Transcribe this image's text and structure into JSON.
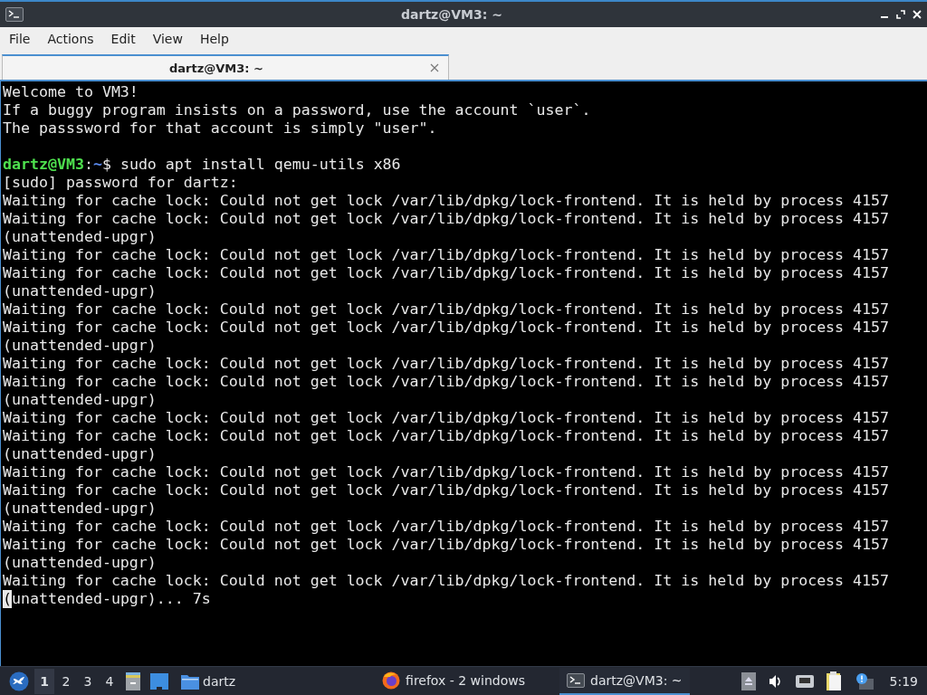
{
  "window": {
    "title": "dartz@VM3: ~"
  },
  "menu": [
    "File",
    "Actions",
    "Edit",
    "View",
    "Help"
  ],
  "tabs": [
    {
      "label": "dartz@VM3: ~",
      "selected": true
    }
  ],
  "terminal": {
    "lines": [
      {
        "kind": "output",
        "text": "Welcome to VM3!"
      },
      {
        "kind": "output",
        "text": "If a buggy program insists on a password, use the account `user`."
      },
      {
        "kind": "output",
        "text": "The passsword for that account is simply \"user\"."
      },
      {
        "kind": "blank"
      },
      {
        "kind": "prompt",
        "user": "dartz@VM3",
        "sep": ":",
        "path": "~",
        "text": "$ sudo apt install qemu-utils x86"
      },
      {
        "kind": "output",
        "text": "[sudo] password for dartz:"
      },
      {
        "kind": "output",
        "text": "Waiting for cache lock: Could not get lock /var/lib/dpkg/lock-frontend. It is held by process 4157"
      },
      {
        "kind": "output",
        "text": "Waiting for cache lock: Could not get lock /var/lib/dpkg/lock-frontend. It is held by process 4157"
      },
      {
        "kind": "output",
        "text": "(unattended-upgr)"
      },
      {
        "kind": "output",
        "text": "Waiting for cache lock: Could not get lock /var/lib/dpkg/lock-frontend. It is held by process 4157"
      },
      {
        "kind": "output",
        "text": "Waiting for cache lock: Could not get lock /var/lib/dpkg/lock-frontend. It is held by process 4157"
      },
      {
        "kind": "output",
        "text": "(unattended-upgr)"
      },
      {
        "kind": "output",
        "text": "Waiting for cache lock: Could not get lock /var/lib/dpkg/lock-frontend. It is held by process 4157"
      },
      {
        "kind": "output",
        "text": "Waiting for cache lock: Could not get lock /var/lib/dpkg/lock-frontend. It is held by process 4157"
      },
      {
        "kind": "output",
        "text": "(unattended-upgr)"
      },
      {
        "kind": "output",
        "text": "Waiting for cache lock: Could not get lock /var/lib/dpkg/lock-frontend. It is held by process 4157"
      },
      {
        "kind": "output",
        "text": "Waiting for cache lock: Could not get lock /var/lib/dpkg/lock-frontend. It is held by process 4157"
      },
      {
        "kind": "output",
        "text": "(unattended-upgr)"
      },
      {
        "kind": "output",
        "text": "Waiting for cache lock: Could not get lock /var/lib/dpkg/lock-frontend. It is held by process 4157"
      },
      {
        "kind": "output",
        "text": "Waiting for cache lock: Could not get lock /var/lib/dpkg/lock-frontend. It is held by process 4157"
      },
      {
        "kind": "output",
        "text": "(unattended-upgr)"
      },
      {
        "kind": "output",
        "text": "Waiting for cache lock: Could not get lock /var/lib/dpkg/lock-frontend. It is held by process 4157"
      },
      {
        "kind": "output",
        "text": "Waiting for cache lock: Could not get lock /var/lib/dpkg/lock-frontend. It is held by process 4157"
      },
      {
        "kind": "output",
        "text": "(unattended-upgr)"
      },
      {
        "kind": "output",
        "text": "Waiting for cache lock: Could not get lock /var/lib/dpkg/lock-frontend. It is held by process 4157"
      },
      {
        "kind": "output",
        "text": "Waiting for cache lock: Could not get lock /var/lib/dpkg/lock-frontend. It is held by process 4157"
      },
      {
        "kind": "output",
        "text": "(unattended-upgr)"
      },
      {
        "kind": "output",
        "text": "Waiting for cache lock: Could not get lock /var/lib/dpkg/lock-frontend. It is held by process 4157"
      },
      {
        "kind": "output",
        "cursor_char": "(",
        "text": "unattended-upgr)... 7s"
      }
    ]
  },
  "taskbar": {
    "workspaces": [
      {
        "label": "1",
        "selected": true
      },
      {
        "label": "2",
        "selected": false
      },
      {
        "label": "3",
        "selected": false
      },
      {
        "label": "4",
        "selected": false
      }
    ],
    "launcher": {
      "label": "dartz"
    },
    "tasks": [
      {
        "kind": "browser",
        "label": "firefox - 2 windows",
        "selected": false
      },
      {
        "kind": "terminal",
        "label": "dartz@VM3: ~",
        "selected": true
      }
    ],
    "clock": "5:19"
  }
}
